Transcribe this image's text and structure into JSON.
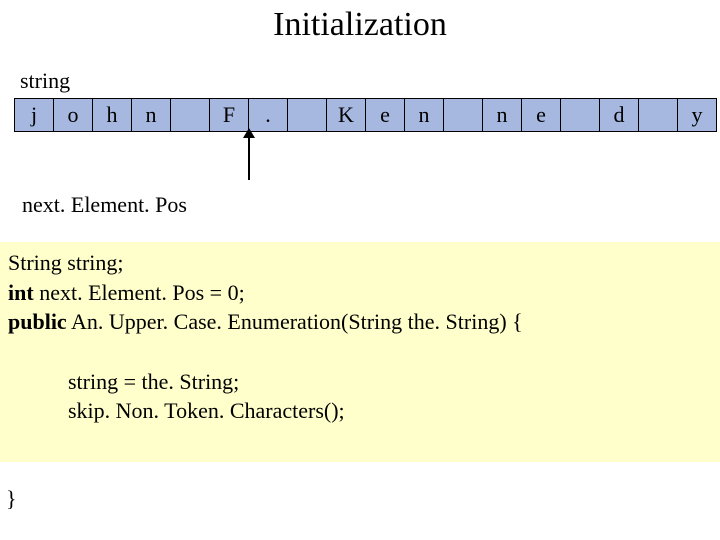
{
  "title": "Initialization",
  "string_label": "string",
  "cells": [
    "j",
    "o",
    "h",
    "n",
    "",
    "F",
    ".",
    "",
    "K",
    "e",
    "n",
    "",
    "n",
    "e",
    "",
    "d",
    "",
    "y"
  ],
  "next_label": "next. Element. Pos",
  "code": {
    "l1a": "String string;",
    "l2kw": "int",
    "l2rest": " next. Element. Pos = 0;",
    "l3kw": "public",
    "l3rest": " An. Upper. Case. Enumeration(String the. String) {",
    "l4": "string = the. String;",
    "l5": "skip. Non. Token. Characters();",
    "close": "}"
  }
}
